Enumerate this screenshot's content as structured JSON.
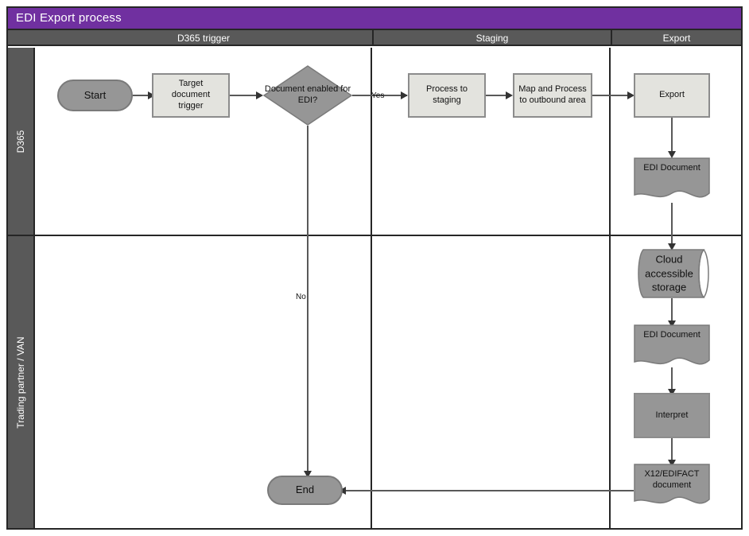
{
  "title": "EDI Export process",
  "theme": {
    "title_bar": "#7030A0",
    "lane_header": "#595959",
    "process_fill": "#E3E3DE",
    "gray_fill": "#969696",
    "border": "#262626",
    "connector": "#595959"
  },
  "phases": [
    {
      "label": "D365 trigger"
    },
    {
      "label": "Staging"
    },
    {
      "label": "Export"
    }
  ],
  "lanes": [
    {
      "label": "D365"
    },
    {
      "label": "Trading partner / VAN"
    }
  ],
  "nodes": {
    "start": {
      "label": "Start",
      "shape": "terminator"
    },
    "target_trig": {
      "label": "Target document trigger",
      "shape": "process"
    },
    "decision": {
      "label": "Document enabled for EDI?",
      "shape": "decision"
    },
    "proc_staging": {
      "label": "Process to staging",
      "shape": "process"
    },
    "map_proc": {
      "label": "Map and Process to outbound area",
      "shape": "process"
    },
    "export": {
      "label": "Export",
      "shape": "process"
    },
    "edi_doc_1": {
      "label": "EDI Document",
      "shape": "document"
    },
    "cloud": {
      "label": "Cloud accessible storage",
      "shape": "cylinder"
    },
    "edi_doc_2": {
      "label": "EDI Document",
      "shape": "document"
    },
    "interpret": {
      "label": "Interpret",
      "shape": "process-gray"
    },
    "x12": {
      "label": "X12/EDIFACT document",
      "shape": "document"
    },
    "end": {
      "label": "End",
      "shape": "terminator"
    }
  },
  "edge_labels": {
    "yes": "Yes",
    "no": "No"
  }
}
